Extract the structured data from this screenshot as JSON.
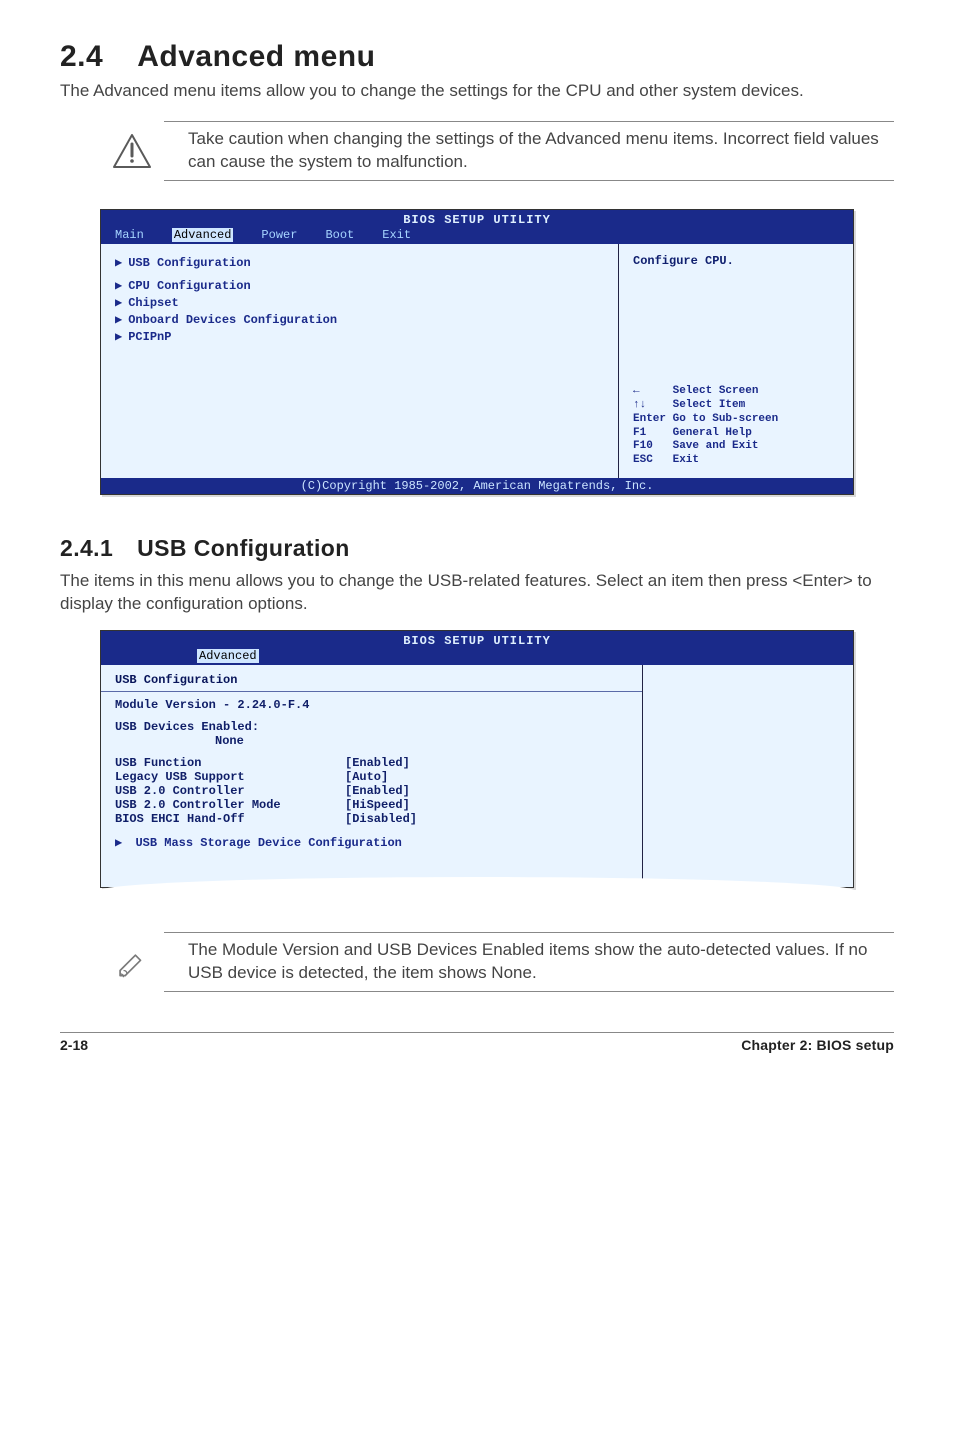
{
  "heading": {
    "number": "2.4",
    "title": "Advanced menu"
  },
  "intro": "The Advanced menu items allow you to change the settings for the CPU and other system devices.",
  "caution": "Take caution when changing the settings of the Advanced menu items. Incorrect field values can cause the system to malfunction.",
  "bios_main": {
    "title": "BIOS SETUP UTILITY",
    "tabs": [
      "Main",
      "Advanced",
      "Power",
      "Boot",
      "Exit"
    ],
    "active_tab": "Advanced",
    "items": [
      "USB Configuration",
      "CPU Configuration",
      "Chipset",
      "Onboard Devices Configuration",
      "PCIPnP"
    ],
    "help_top": "Configure CPU.",
    "keys": "←     Select Screen\n↑↓    Select Item\nEnter Go to Sub-screen\nF1    General Help\nF10   Save and Exit\nESC   Exit",
    "footer": "(C)Copyright 1985-2002, American Megatrends, Inc."
  },
  "subheading": {
    "number": "2.4.1",
    "title": "USB Configuration"
  },
  "sub_intro": "The items in this menu allows you to change the USB-related features. Select an item then press <Enter> to display the configuration options.",
  "bios_sub": {
    "title": "BIOS SETUP UTILITY",
    "tab": "Advanced",
    "header": "USB Configuration",
    "module_line": "Module Version - 2.24.0-F.4",
    "devices_enabled_label": "USB Devices Enabled:",
    "devices_enabled_value": "None",
    "settings": [
      {
        "k": "USB Function",
        "v": "[Enabled]"
      },
      {
        "k": "Legacy USB Support",
        "v": "[Auto]"
      },
      {
        "k": "USB 2.0 Controller",
        "v": "[Enabled]"
      },
      {
        "k": "USB 2.0 Controller Mode",
        "v": "[HiSpeed]"
      },
      {
        "k": "BIOS EHCI Hand-Off",
        "v": "[Disabled]"
      }
    ],
    "subitem": "USB Mass Storage Device Configuration"
  },
  "note2": "The Module Version and USB Devices Enabled items show the auto-detected values. If no USB device is detected, the item shows None.",
  "footer": {
    "left": "2-18",
    "right": "Chapter 2: BIOS setup"
  },
  "chart_data": {
    "type": "table",
    "title": "USB Configuration settings",
    "rows": [
      [
        "USB Function",
        "[Enabled]"
      ],
      [
        "Legacy USB Support",
        "[Auto]"
      ],
      [
        "USB 2.0 Controller",
        "[Enabled]"
      ],
      [
        "USB 2.0 Controller Mode",
        "[HiSpeed]"
      ],
      [
        "BIOS EHCI Hand-Off",
        "[Disabled]"
      ]
    ]
  }
}
